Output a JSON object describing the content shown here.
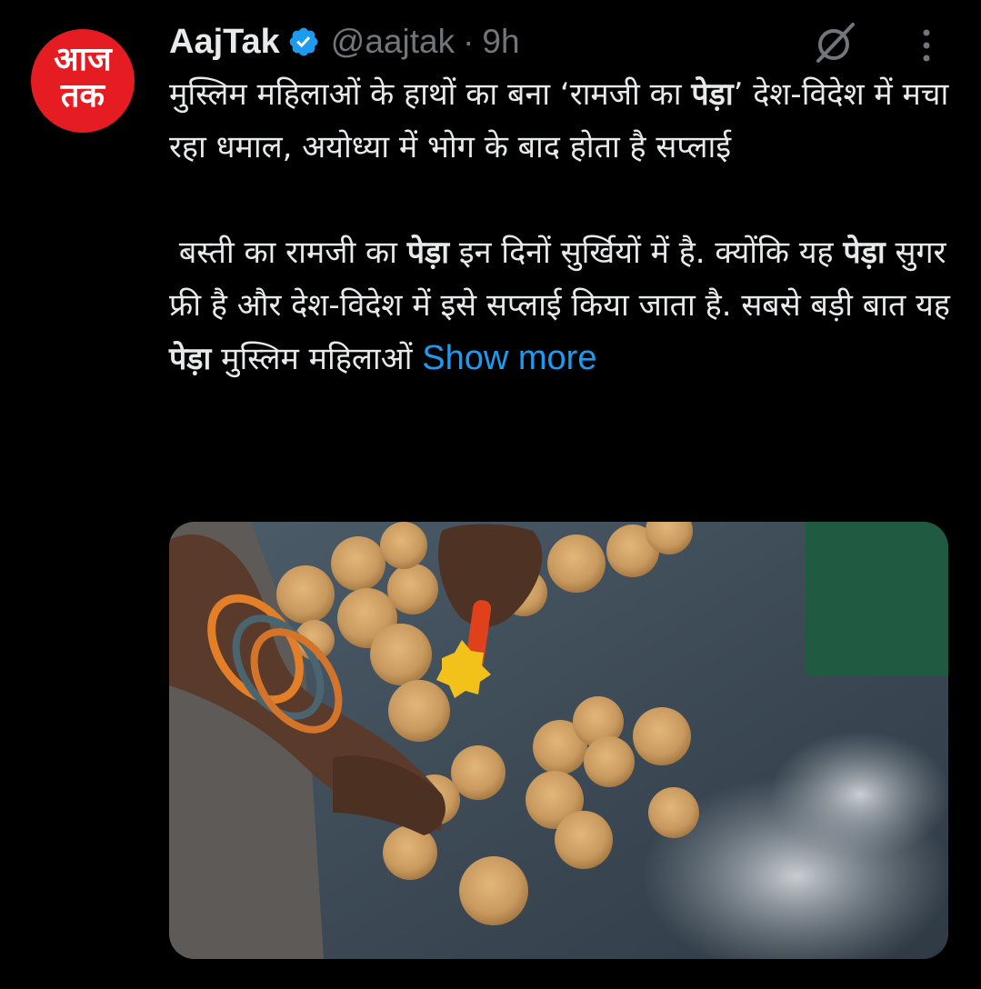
{
  "author": {
    "name": "AajTak",
    "handle": "@aajtak",
    "separator": "·",
    "time": "9h",
    "avatar_text_line1": "आज",
    "avatar_text_line2": "तक",
    "verified_color": "#1d9bf0",
    "avatar_color": "#e51d23"
  },
  "tweet": {
    "headline_part1": "मुस्लिम महिलाओं के हाथों का बना ‘रामजी का ",
    "headline_bold": "पेड़ा",
    "headline_part2": "’ देश-विदेश में मचा रहा धमाल, अयोध्या में भोग के बाद होता है सप्लाई",
    "para_part1": " बस्ती का रामजी का ",
    "para_bold1": "पेड़ा",
    "para_part2": " इन दिनों सुर्खियों में है. क्योंकि यह ",
    "para_bold2": "पेड़ा",
    "para_part3": " सुगर फ्री है और देश-विदेश में इसे सप्लाई किया जाता है. सबसे बड़ी बात यह ",
    "para_bold3": "पेड़ा",
    "para_part4": " मुस्लिम महिलाओं ",
    "show_more": "Show more",
    "link_color": "#1d9bf0"
  },
  "icons": {
    "grok": "grok-slash-circle-icon",
    "more": "vertical-ellipsis-icon",
    "verified": "verified-badge-icon"
  },
  "media": {
    "subject": "photo-of-pedas-being-made"
  }
}
